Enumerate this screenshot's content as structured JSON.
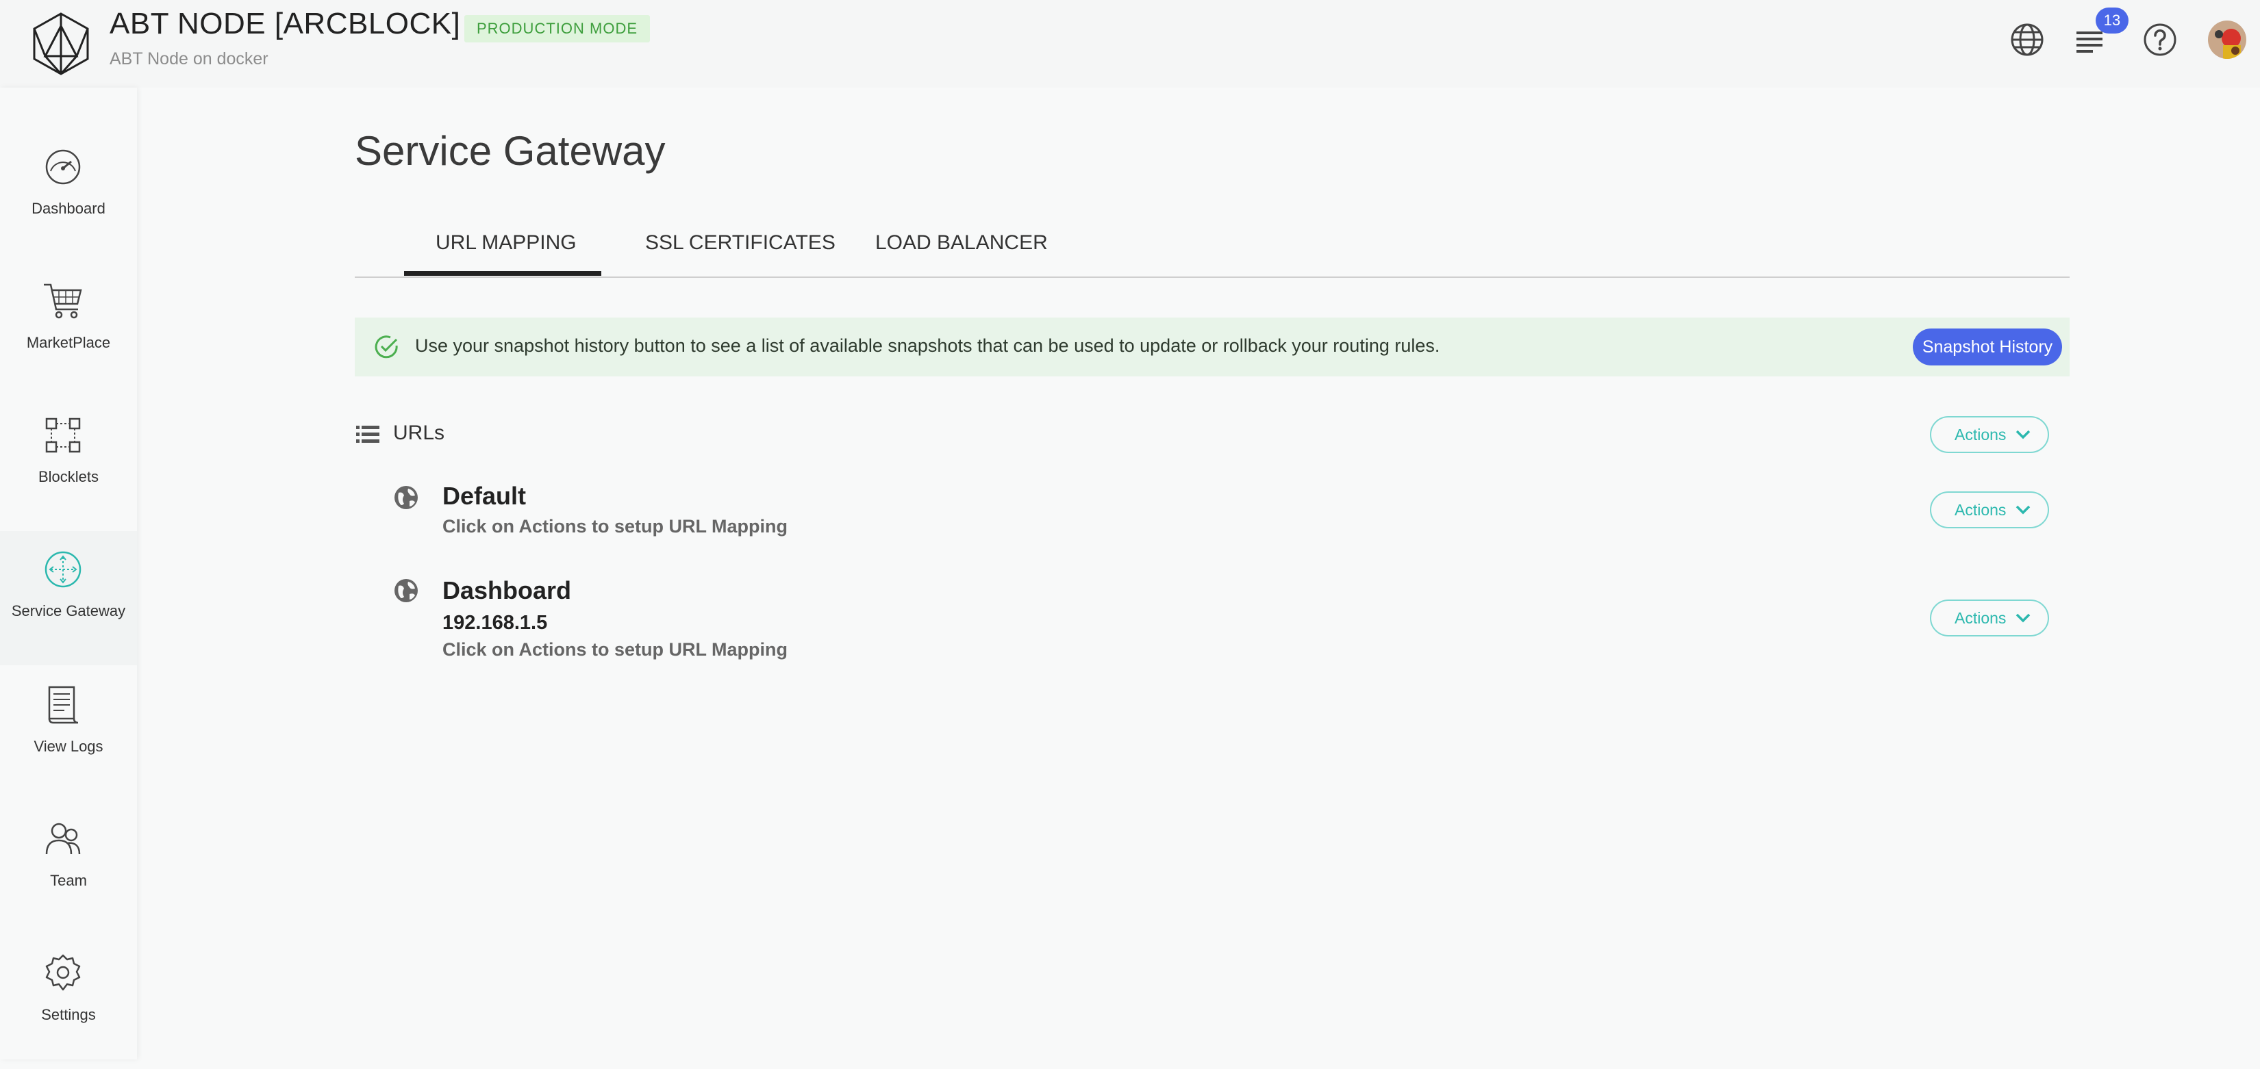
{
  "header": {
    "title": "ABT NODE [ARCBLOCK]",
    "mode_badge": "PRODUCTION MODE",
    "subtitle": "ABT Node on docker",
    "notifications_count": "13",
    "icons": [
      "globe-icon",
      "notifications-icon",
      "help-icon",
      "user-avatar"
    ]
  },
  "sidebar": {
    "items": [
      {
        "label": "Dashboard",
        "icon": "speedometer-icon"
      },
      {
        "label": "MarketPlace",
        "icon": "cart-icon"
      },
      {
        "label": "Blocklets",
        "icon": "blocks-icon"
      },
      {
        "label": "Service Gateway",
        "icon": "gateway-icon",
        "active": true
      },
      {
        "label": "View Logs",
        "icon": "logs-icon"
      },
      {
        "label": "Team",
        "icon": "team-icon"
      },
      {
        "label": "Settings",
        "icon": "gear-icon"
      }
    ]
  },
  "main": {
    "title": "Service Gateway",
    "tabs": [
      {
        "label": "URL MAPPING",
        "active": true
      },
      {
        "label": "SSL CERTIFICATES"
      },
      {
        "label": "LOAD BALANCER"
      }
    ],
    "alert": {
      "text": "Use your snapshot history button to see a list of available snapshots that can be used to update or rollback your routing rules.",
      "button": "Snapshot History"
    },
    "section": {
      "title": "URLs",
      "actions_label": "Actions"
    },
    "rules": [
      {
        "name": "Default",
        "ip": "",
        "hint": "Click on Actions to setup URL Mapping",
        "actions_label": "Actions"
      },
      {
        "name": "Dashboard",
        "ip": "192.168.1.5",
        "hint": "Click on Actions to setup URL Mapping",
        "actions_label": "Actions"
      }
    ]
  },
  "colors": {
    "accent": "#4a67e8",
    "teal": "#2bb8ae",
    "badge_green": "#3d9e3c",
    "alert_bg": "#e8f4e9"
  }
}
